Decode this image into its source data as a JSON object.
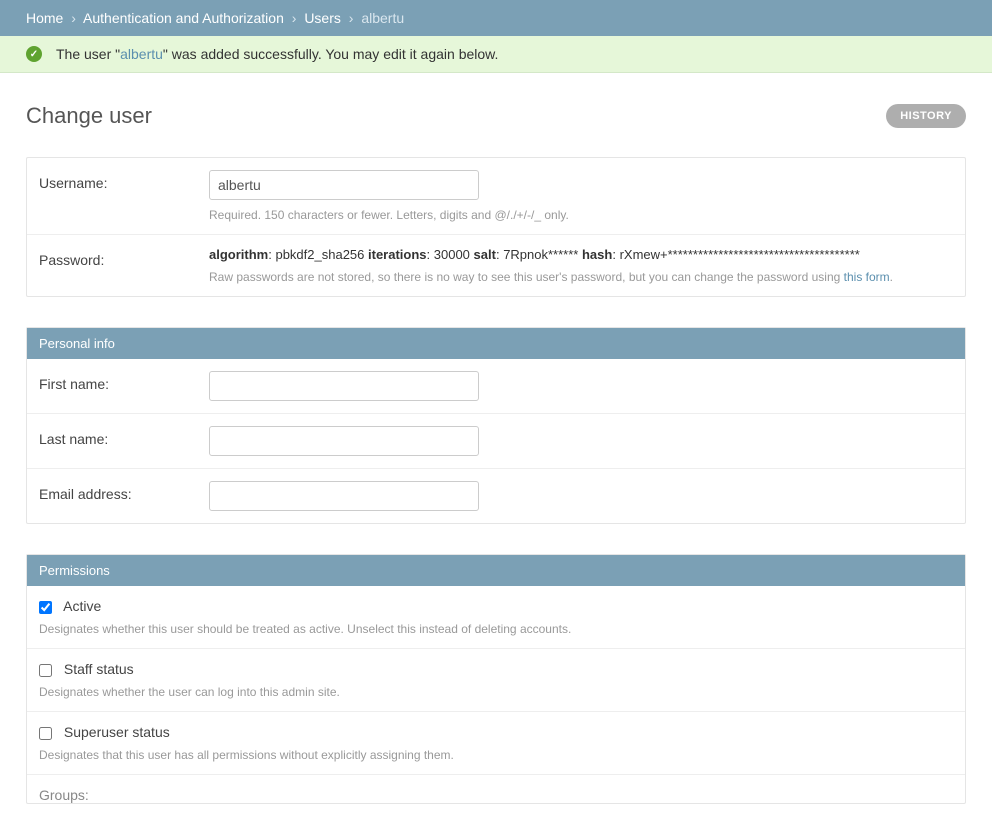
{
  "breadcrumbs": {
    "home": "Home",
    "auth": "Authentication and Authorization",
    "users": "Users",
    "current": "albertu"
  },
  "message": {
    "pre": "The user \"",
    "user": "albertu",
    "post": "\" was added successfully. You may edit it again below."
  },
  "page_title": "Change user",
  "history_btn": "HISTORY",
  "username": {
    "label": "Username:",
    "value": "albertu",
    "help": "Required. 150 characters or fewer. Letters, digits and @/./+/-/_ only."
  },
  "password": {
    "label": "Password:",
    "algorithm_label": "algorithm",
    "algorithm": "pbkdf2_sha256",
    "iterations_label": "iterations",
    "iterations": "30000",
    "salt_label": "salt",
    "salt": "7Rpnok******",
    "hash_label": "hash",
    "hash": "rXmew+**************************************",
    "help_pre": "Raw passwords are not stored, so there is no way to see this user's password, but you can change the password using ",
    "help_link": "this form",
    "help_post": "."
  },
  "personal_info": {
    "heading": "Personal info",
    "first_name": "First name:",
    "last_name": "Last name:",
    "email": "Email address:"
  },
  "permissions": {
    "heading": "Permissions",
    "active": {
      "label": "Active",
      "checked": true,
      "help": "Designates whether this user should be treated as active. Unselect this instead of deleting accounts."
    },
    "staff": {
      "label": "Staff status",
      "checked": false,
      "help": "Designates whether the user can log into this admin site."
    },
    "superuser": {
      "label": "Superuser status",
      "checked": false,
      "help": "Designates that this user has all permissions without explicitly assigning them."
    },
    "groups_label": "Groups:"
  }
}
